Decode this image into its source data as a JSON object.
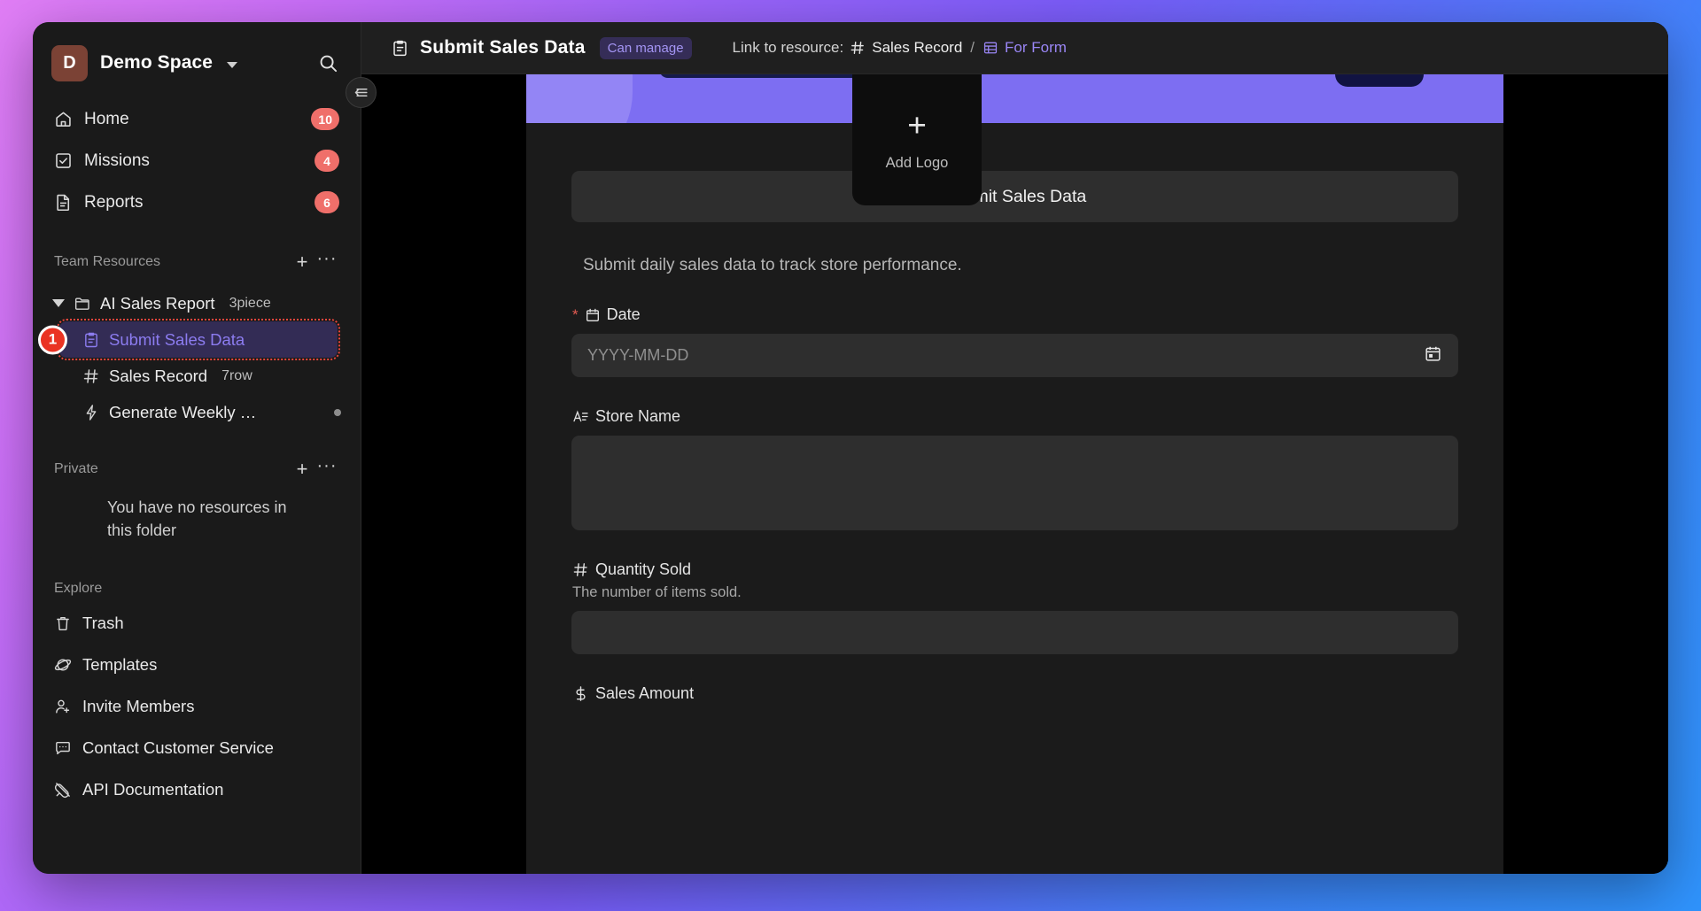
{
  "workspace": {
    "avatar_letter": "D",
    "name": "Demo Space",
    "search_icon": "search-icon",
    "chevron_icon": "chevron-down-icon"
  },
  "sidebar": {
    "nav": [
      {
        "label": "Home",
        "badge": "10",
        "icon": "home-icon"
      },
      {
        "label": "Missions",
        "badge": "4",
        "icon": "checkbox-icon"
      },
      {
        "label": "Reports",
        "badge": "6",
        "icon": "document-icon"
      }
    ],
    "team_resources": {
      "title": "Team Resources",
      "add_label": "+",
      "more_label": "···",
      "folder": {
        "label": "AI Sales Report",
        "count": "3piece",
        "icon": "folder-icon"
      },
      "children": [
        {
          "label": "Submit Sales Data",
          "meta": "",
          "icon": "form-icon",
          "selected": true,
          "marker": "1"
        },
        {
          "label": "Sales Record",
          "meta": "7row",
          "icon": "hash-icon",
          "selected": false
        },
        {
          "label": "Generate Weekly …",
          "meta": "",
          "icon": "bolt-icon",
          "selected": false,
          "dot": true
        }
      ]
    },
    "private": {
      "title": "Private",
      "add_label": "+",
      "more_label": "···",
      "empty_text": "You have no resources in this folder"
    },
    "explore": {
      "title": "Explore",
      "items": [
        {
          "label": "Trash",
          "icon": "trash-icon"
        },
        {
          "label": "Templates",
          "icon": "planet-icon"
        },
        {
          "label": "Invite Members",
          "icon": "user-plus-icon"
        },
        {
          "label": "Contact Customer Service",
          "icon": "chat-icon"
        },
        {
          "label": "API Documentation",
          "icon": "plug-icon"
        }
      ]
    },
    "collapse_icon": "collapse-sidebar-icon"
  },
  "topbar": {
    "doc_icon": "form-icon",
    "doc_title": "Submit Sales Data",
    "permission": "Can manage",
    "link_label": "Link to resource:",
    "link_resource_icon": "hash-icon",
    "link_resource": "Sales Record",
    "separator": "/",
    "link_view_icon": "table-icon",
    "link_view": "For Form"
  },
  "form": {
    "add_logo_label": "Add Logo",
    "add_logo_plus": "+",
    "title": "Submit Sales Data",
    "description": "Submit daily sales data to track store performance.",
    "fields": [
      {
        "label": "Date",
        "required": true,
        "icon": "calendar-icon",
        "help": "",
        "placeholder": "YYYY-MM-DD",
        "trailing_icon": "calendar-picker-icon",
        "type": "date"
      },
      {
        "label": "Store Name",
        "required": false,
        "icon": "text-lines-icon",
        "help": "",
        "placeholder": "",
        "type": "textarea"
      },
      {
        "label": "Quantity Sold",
        "required": false,
        "icon": "hash-icon",
        "help": "The number of items sold.",
        "placeholder": "",
        "type": "number"
      },
      {
        "label": "Sales Amount",
        "required": false,
        "icon": "dollar-icon",
        "help": "",
        "placeholder": "",
        "type": "currency"
      }
    ]
  },
  "colors": {
    "accent_purple": "#8c7cf0",
    "banner_purple": "#7d6ef2",
    "badge_red": "#ef6f6a",
    "marker_red": "#ea3323",
    "sidebar_bg": "#1a1a1a",
    "panel_bg": "#1b1b1b",
    "input_bg": "#2e2e2e"
  }
}
